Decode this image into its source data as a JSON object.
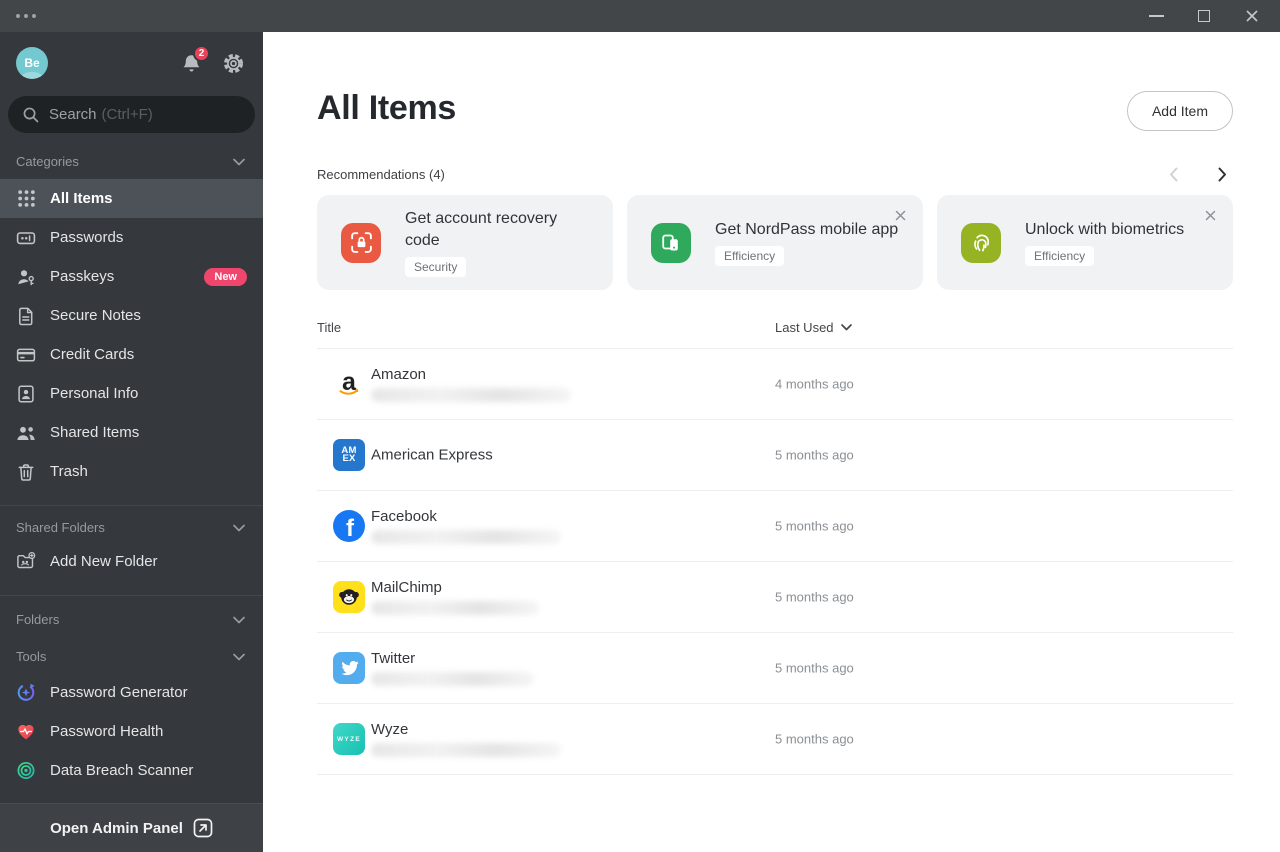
{
  "sidebar": {
    "avatar_initials": "Be",
    "notification_count": "2",
    "search_placeholder": "Search",
    "search_hint": "(Ctrl+F)",
    "categories_label": "Categories",
    "categories": [
      {
        "label": "All Items",
        "icon": "grid-icon",
        "selected": true
      },
      {
        "label": "Passwords",
        "icon": "passwords-icon"
      },
      {
        "label": "Passkeys",
        "icon": "passkeys-icon",
        "badge": "New"
      },
      {
        "label": "Secure Notes",
        "icon": "secure-note-icon"
      },
      {
        "label": "Credit Cards",
        "icon": "credit-card-icon"
      },
      {
        "label": "Personal Info",
        "icon": "personal-info-icon"
      },
      {
        "label": "Shared Items",
        "icon": "shared-items-icon"
      },
      {
        "label": "Trash",
        "icon": "trash-icon"
      }
    ],
    "shared_folders_label": "Shared Folders",
    "add_new_folder_label": "Add New Folder",
    "folders_label": "Folders",
    "tools_label": "Tools",
    "tools": [
      {
        "label": "Password Generator",
        "icon": "password-generator-icon"
      },
      {
        "label": "Password Health",
        "icon": "password-health-icon"
      },
      {
        "label": "Data Breach Scanner",
        "icon": "data-breach-scanner-icon"
      }
    ],
    "admin_panel_label": "Open Admin Panel"
  },
  "main": {
    "title": "All Items",
    "add_item_label": "Add Item",
    "recommendations_label": "Recommendations (4)",
    "cards": [
      {
        "title": "Get account recovery code",
        "tag": "Security",
        "icon": "recovery-code-icon",
        "icon_color": "#ea5a43",
        "closable": false
      },
      {
        "title": "Get NordPass mobile app",
        "tag": "Efficiency",
        "icon": "mobile-app-icon",
        "icon_color": "#2fa95c",
        "closable": true
      },
      {
        "title": "Unlock with biometrics",
        "tag": "Efficiency",
        "icon": "biometrics-icon",
        "icon_color": "#96b324",
        "closable": true
      }
    ],
    "table": {
      "title_column": "Title",
      "last_used_column": "Last Used",
      "rows": [
        {
          "title": "Amazon",
          "last_used": "4 months ago",
          "icon": "amazon-logo",
          "masked_username": true
        },
        {
          "title": "American Express",
          "last_used": "5 months ago",
          "icon": "amex-logo",
          "masked_username": false
        },
        {
          "title": "Facebook",
          "last_used": "5 months ago",
          "icon": "facebook-logo",
          "masked_username": true
        },
        {
          "title": "MailChimp",
          "last_used": "5 months ago",
          "icon": "mailchimp-logo",
          "masked_username": true
        },
        {
          "title": "Twitter",
          "last_used": "5 months ago",
          "icon": "twitter-logo",
          "masked_username": true
        },
        {
          "title": "Wyze",
          "last_used": "5 months ago",
          "icon": "wyze-logo",
          "masked_username": true
        }
      ]
    }
  },
  "logos": {
    "amazon": "a",
    "amex_top": "AM",
    "amex_bottom": "EX",
    "facebook": "f",
    "wyze": "WYZE"
  },
  "colors": {
    "accent_orange": "#ea5a43",
    "accent_green": "#2fa95c",
    "accent_olive": "#96b324",
    "badge_pink": "#f0466d",
    "notification_red": "#e84358",
    "avatar_teal": "#74c8cf"
  }
}
